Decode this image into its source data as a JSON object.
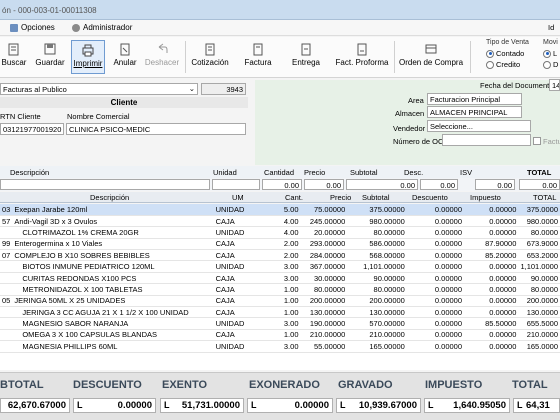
{
  "window": {
    "title": "ón - 000-003-01-00011308"
  },
  "menu": {
    "items": [
      {
        "label": "Opciones"
      },
      {
        "label": "Administrador"
      }
    ],
    "right_label": "Id"
  },
  "toolbar": {
    "buttons": [
      {
        "label": "Buscar"
      },
      {
        "label": "Guardar"
      },
      {
        "label": "Imprimir"
      },
      {
        "label": "Anular"
      },
      {
        "label": "Deshacer"
      },
      {
        "label": "Cotización"
      },
      {
        "label": "Factura"
      },
      {
        "label": "Entrega"
      },
      {
        "label": "Fact. Proforma"
      },
      {
        "label": "Orden de Compra"
      }
    ],
    "tipo_venta": {
      "label": "Tipo de Venta",
      "options": [
        "Contado",
        "Credito"
      ],
      "selected": "Contado"
    },
    "movimiento": {
      "label": "Movi",
      "options": [
        "L",
        "D"
      ]
    }
  },
  "header": {
    "price_list": "Facturas al Publico",
    "price_code": "3943",
    "client_section": "Cliente",
    "rtn_label": "RTN Cliente",
    "rtn_value": "03121977001920",
    "nombre_label": "Nombre Comercial",
    "nombre_value": "CLINICA PSICO-MEDIC",
    "fecha_label": "Fecha del Documento",
    "fecha_value": "14",
    "area_label": "Area",
    "area_value": "Facturacion Principal",
    "almacen_label": "Almacen",
    "almacen_value": "ALMACEN PRINCIPAL",
    "vendedor_label": "Vendedor",
    "vendedor_value": "Seleccione...",
    "oc_label": "Número de OC",
    "factu_label": "Factu"
  },
  "entry_row": {
    "labels": [
      "Descripción",
      "Unidad",
      "Cantidad",
      "Precio",
      "Subtotal",
      "Desc.",
      "ISV",
      "TOTAL"
    ],
    "values": [
      "0.00",
      "0.00",
      "0.00",
      "0.00",
      "0.00",
      "0.00"
    ]
  },
  "grid": {
    "columns": [
      "Descripción",
      "UM",
      "Cant.",
      "Precio",
      "Subtotal",
      "Descuento",
      "Impuesto",
      "TOTAL"
    ],
    "rows": [
      {
        "pre": "03",
        "desc": "Exepan Jarabe 120ml",
        "um": "UNIDAD",
        "cant": "5.00",
        "precio": "75.00000",
        "subtotal": "375.00000",
        "descuento": "0.00000",
        "impuesto": "0.00000",
        "total": "375.0000",
        "selected": true
      },
      {
        "pre": "57",
        "desc": "Andi-Vagil 3D x 3 Ovulos",
        "um": "CAJA",
        "cant": "4.00",
        "precio": "245.00000",
        "subtotal": "980.00000",
        "descuento": "0.00000",
        "impuesto": "0.00000",
        "total": "980.0000"
      },
      {
        "pre": "",
        "desc": "CLOTRIMAZOL 1% CREMA 20GR",
        "um": "UNIDAD",
        "cant": "4.00",
        "precio": "20.00000",
        "subtotal": "80.00000",
        "descuento": "0.00000",
        "impuesto": "0.00000",
        "total": "80.0000"
      },
      {
        "pre": "99",
        "desc": "Enterogermina x 10 Viales",
        "um": "CAJA",
        "cant": "2.00",
        "precio": "293.00000",
        "subtotal": "586.00000",
        "descuento": "0.00000",
        "impuesto": "87.90000",
        "total": "673.9000"
      },
      {
        "pre": "07",
        "desc": "COMPLEJO B X10 SOBRES BEBIBLES",
        "um": "CAJA",
        "cant": "2.00",
        "precio": "284.00000",
        "subtotal": "568.00000",
        "descuento": "0.00000",
        "impuesto": "85.20000",
        "total": "653.2000"
      },
      {
        "pre": "",
        "desc": "BIOTOS INMUNE PEDIATRICO 120ML",
        "um": "UNIDAD",
        "cant": "3.00",
        "precio": "367.00000",
        "subtotal": "1,101.00000",
        "descuento": "0.00000",
        "impuesto": "0.00000",
        "total": "1,101.0000"
      },
      {
        "pre": "",
        "desc": "CURITAS REDONDAS X100 PCS",
        "um": "CAJA",
        "cant": "3.00",
        "precio": "30.00000",
        "subtotal": "90.00000",
        "descuento": "0.00000",
        "impuesto": "0.00000",
        "total": "90.0000"
      },
      {
        "pre": "",
        "desc": "METRONIDAZOL X 100 TABLETAS",
        "um": "CAJA",
        "cant": "1.00",
        "precio": "80.00000",
        "subtotal": "80.00000",
        "descuento": "0.00000",
        "impuesto": "0.00000",
        "total": "80.0000"
      },
      {
        "pre": "05",
        "desc": "JERINGA 50ML X 25 UNIDADES",
        "um": "CAJA",
        "cant": "1.00",
        "precio": "200.00000",
        "subtotal": "200.00000",
        "descuento": "0.00000",
        "impuesto": "0.00000",
        "total": "200.0000"
      },
      {
        "pre": "",
        "desc": "JERINGA 3 CC AGUJA 21 X 1 1/2 X 100 UNIDAD",
        "um": "CAJA",
        "cant": "1.00",
        "precio": "130.00000",
        "subtotal": "130.00000",
        "descuento": "0.00000",
        "impuesto": "0.00000",
        "total": "130.0000"
      },
      {
        "pre": "",
        "desc": "MAGNESIO SABOR NARANJA",
        "um": "UNIDAD",
        "cant": "3.00",
        "precio": "190.00000",
        "subtotal": "570.00000",
        "descuento": "0.00000",
        "impuesto": "85.50000",
        "total": "655.5000"
      },
      {
        "pre": "",
        "desc": "OMEGA 3 X 100 CAPSULAS BLANDAS",
        "um": "CAJA",
        "cant": "1.00",
        "precio": "210.00000",
        "subtotal": "210.00000",
        "descuento": "0.00000",
        "impuesto": "0.00000",
        "total": "210.0000"
      },
      {
        "pre": "",
        "desc": "MAGNESIA PHILLIPS 60ML",
        "um": "UNIDAD",
        "cant": "3.00",
        "precio": "55.00000",
        "subtotal": "165.00000",
        "descuento": "0.00000",
        "impuesto": "0.00000",
        "total": "165.0000"
      }
    ]
  },
  "totals": {
    "subtotal_label": "BTOTAL",
    "subtotal_value": "62,670.67000",
    "descuento_label": "DESCUENTO",
    "descuento_value": "0.00000",
    "exento_label": "EXENTO",
    "exento_value": "51,731.00000",
    "exonerado_label": "EXONERADO",
    "exonerado_value": "0.00000",
    "gravado_label": "GRAVADO",
    "gravado_value": "10,939.67000",
    "impuesto_label": "IMPUESTO",
    "impuesto_value": "1,640.95050",
    "total_label": "TOTAL",
    "total_value": "64,31",
    "currency": "L"
  },
  "colors": {
    "title_bar": "#c9dcef",
    "selected_row": "#cfe0f6",
    "panel_green": "#e7f1e7",
    "totals_bg": "#e3e3e3"
  }
}
